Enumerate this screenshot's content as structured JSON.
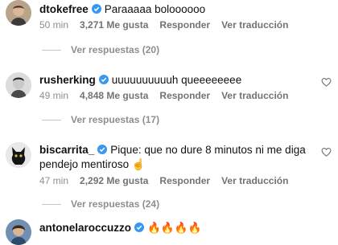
{
  "comments": [
    {
      "username": "dtokefree",
      "text": "Paraaaaa boloooooo",
      "time": "50 min",
      "likes": "3,271 Me gusta",
      "reply_label": "Responder",
      "translate_label": "Ver traducción",
      "view_replies": "Ver respuestas (20)",
      "verified": true
    },
    {
      "username": "rusherking",
      "text": "uuuuuuuuuuh queeeeeeee",
      "time": "49 min",
      "likes": "4,848 Me gusta",
      "reply_label": "Responder",
      "translate_label": "Ver traducción",
      "view_replies": "Ver respuestas (17)",
      "verified": true
    },
    {
      "username": "biscarrita_",
      "text": "Pique: que no dure 8 minutos ni me diga",
      "text_line2": "pendejo mentiroso ☝️",
      "time": "47 min",
      "likes": "2,292 Me gusta",
      "reply_label": "Responder",
      "translate_label": "Ver traducción",
      "view_replies": "Ver respuestas (24)",
      "verified": true
    },
    {
      "username": "antonelaroccuzzo",
      "text": "🔥🔥🔥🔥",
      "verified": true
    }
  ],
  "colors": {
    "verified_blue": "#3897f0",
    "secondary_text": "#8e8e8e"
  },
  "icons": {
    "verified": "verified-badge-icon",
    "like": "heart-outline-icon"
  }
}
